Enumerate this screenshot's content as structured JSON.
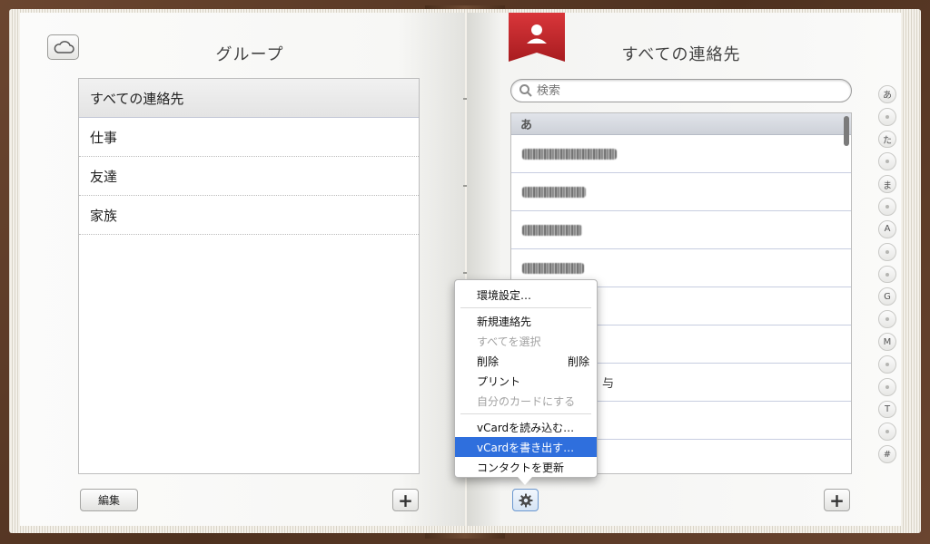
{
  "groups": {
    "title": "グループ",
    "items": [
      {
        "label": "すべての連絡先"
      },
      {
        "label": "仕事"
      },
      {
        "label": "友達"
      },
      {
        "label": "家族"
      }
    ],
    "edit_label": "編集",
    "add_label": "+"
  },
  "contacts": {
    "title": "すべての連絡先",
    "search_placeholder": "検索",
    "section_label": "あ",
    "row_suffix": "与",
    "add_label": "+",
    "index": [
      "あ",
      "•",
      "た",
      "•",
      "ま",
      "•",
      "A",
      "•",
      "•",
      "G",
      "•",
      "M",
      "•",
      "•",
      "T",
      "•",
      "#"
    ]
  },
  "menu": {
    "items": [
      {
        "label": "環境設定…",
        "shortcut": "",
        "state": "normal"
      },
      {
        "label": "新規連絡先",
        "shortcut": "",
        "state": "normal"
      },
      {
        "label": "すべてを選択",
        "shortcut": "",
        "state": "disabled"
      },
      {
        "label": "削除",
        "shortcut": "削除",
        "state": "normal"
      },
      {
        "label": "プリント",
        "shortcut": "",
        "state": "normal"
      },
      {
        "label": "自分のカードにする",
        "shortcut": "",
        "state": "disabled"
      },
      {
        "label": "vCardを読み込む…",
        "shortcut": "",
        "state": "normal"
      },
      {
        "label": "vCardを書き出す…",
        "shortcut": "",
        "state": "highlight"
      },
      {
        "label": "コンタクトを更新",
        "shortcut": "",
        "state": "normal"
      }
    ]
  },
  "colors": {
    "accent": "#2f6fdd",
    "bookmark_red": "#c8262a",
    "leather": "#5a3b28"
  },
  "icons": [
    "cloud-icon",
    "person-icon",
    "search-icon",
    "gear-icon",
    "plus-icon"
  ]
}
